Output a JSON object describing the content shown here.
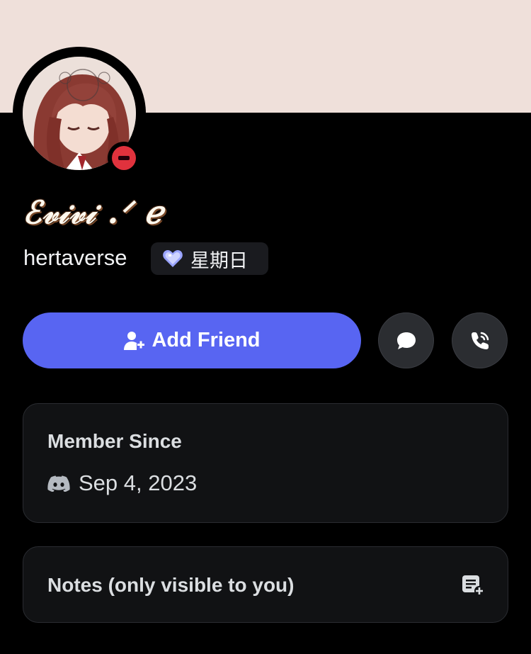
{
  "profile": {
    "display_name": "ℰ𝓋𝒾𝓋𝒾 .ᐟ ℯ",
    "username": "hertaverse",
    "status": "do-not-disturb",
    "clan_tag": "星期日",
    "clan_icon": "heart-icon"
  },
  "actions": {
    "add_friend_label": "Add Friend",
    "message_icon": "chat-bubble-icon",
    "call_icon": "phone-call-icon"
  },
  "member_since": {
    "title": "Member Since",
    "date": "Sep 4, 2023",
    "icon": "discord-logo-icon"
  },
  "notes": {
    "label": "Notes (only visible to you)",
    "icon": "add-note-icon"
  },
  "colors": {
    "banner": "#efe0da",
    "background": "#000000",
    "accent": "#5865f2",
    "card": "#111214",
    "dnd": "#e0323d"
  }
}
